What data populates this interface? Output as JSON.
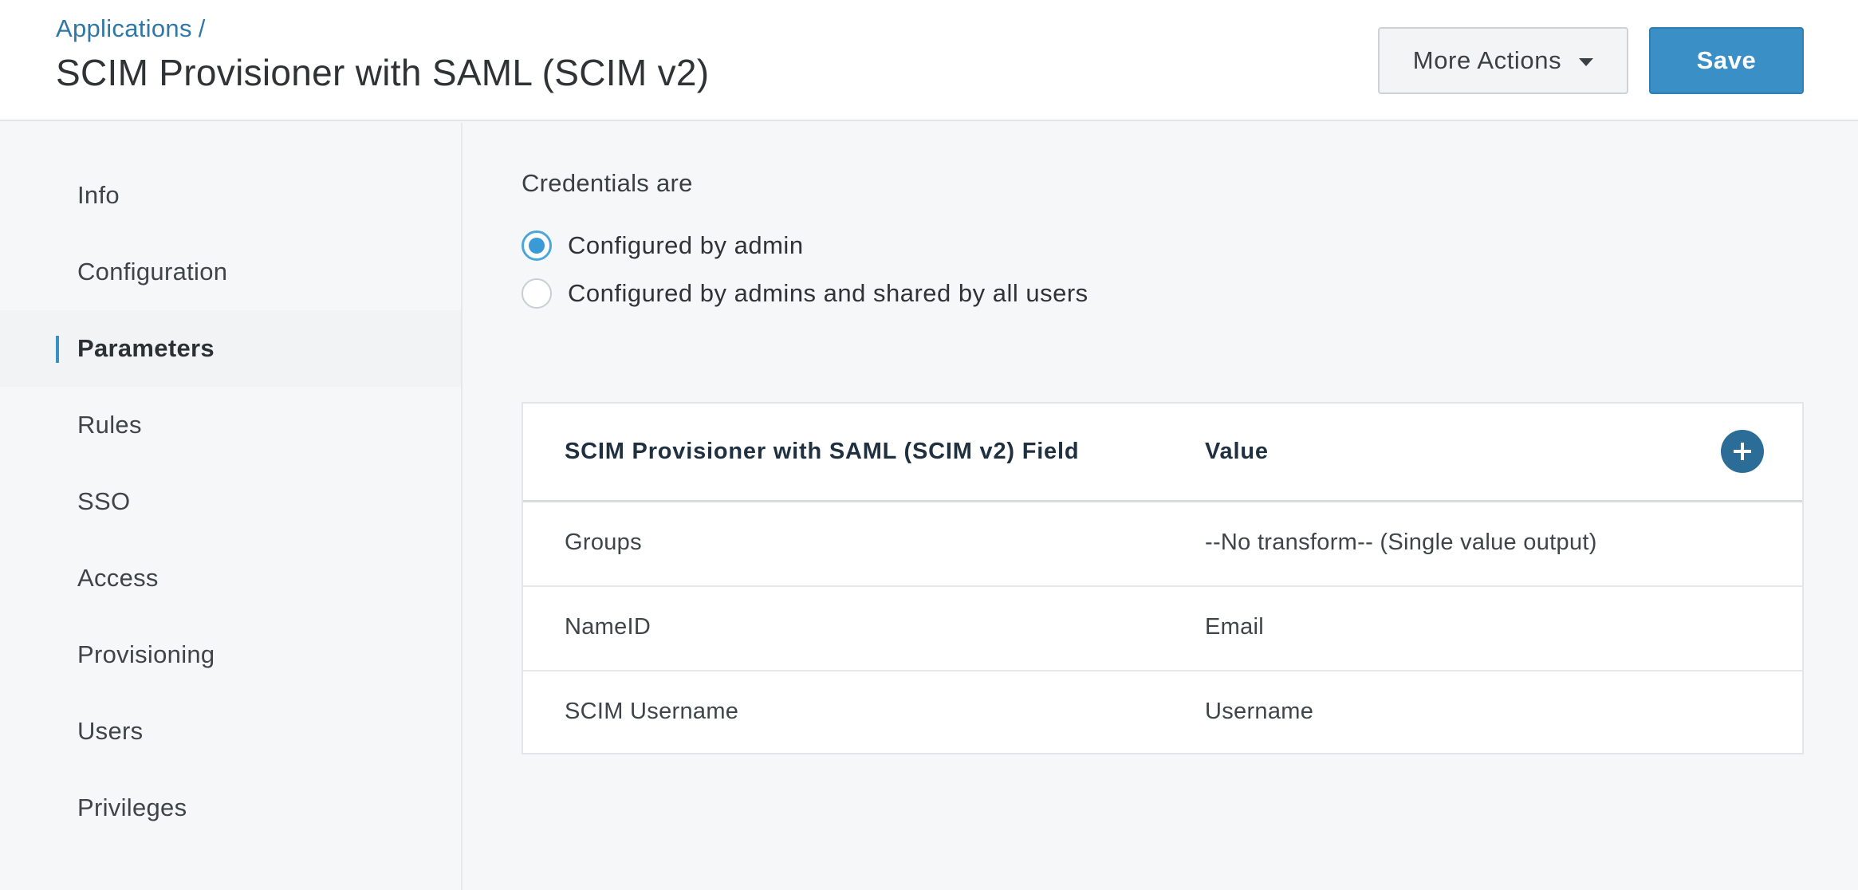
{
  "header": {
    "breadcrumb_link": "Applications",
    "breadcrumb_separator": "/",
    "title": "SCIM Provisioner with SAML (SCIM v2)",
    "more_actions_label": "More Actions",
    "save_label": "Save"
  },
  "sidebar": {
    "items": [
      {
        "label": "Info",
        "active": false
      },
      {
        "label": "Configuration",
        "active": false
      },
      {
        "label": "Parameters",
        "active": true
      },
      {
        "label": "Rules",
        "active": false
      },
      {
        "label": "SSO",
        "active": false
      },
      {
        "label": "Access",
        "active": false
      },
      {
        "label": "Provisioning",
        "active": false
      },
      {
        "label": "Users",
        "active": false
      },
      {
        "label": "Privileges",
        "active": false
      }
    ]
  },
  "credentials": {
    "label": "Credentials are",
    "options": [
      {
        "label": "Configured by admin",
        "selected": true
      },
      {
        "label": "Configured by admins and shared by all users",
        "selected": false
      }
    ]
  },
  "table": {
    "headers": [
      "SCIM Provisioner with SAML (SCIM v2) Field",
      "Value"
    ],
    "add_icon": "plus-icon",
    "rows": [
      [
        "Groups",
        "--No transform-- (Single value output)"
      ],
      [
        "NameID",
        "Email"
      ],
      [
        "SCIM Username",
        "Username"
      ]
    ]
  },
  "colors": {
    "accent": "#3a8fc6",
    "link": "#2f78a6",
    "add_button": "#2b6d97"
  }
}
